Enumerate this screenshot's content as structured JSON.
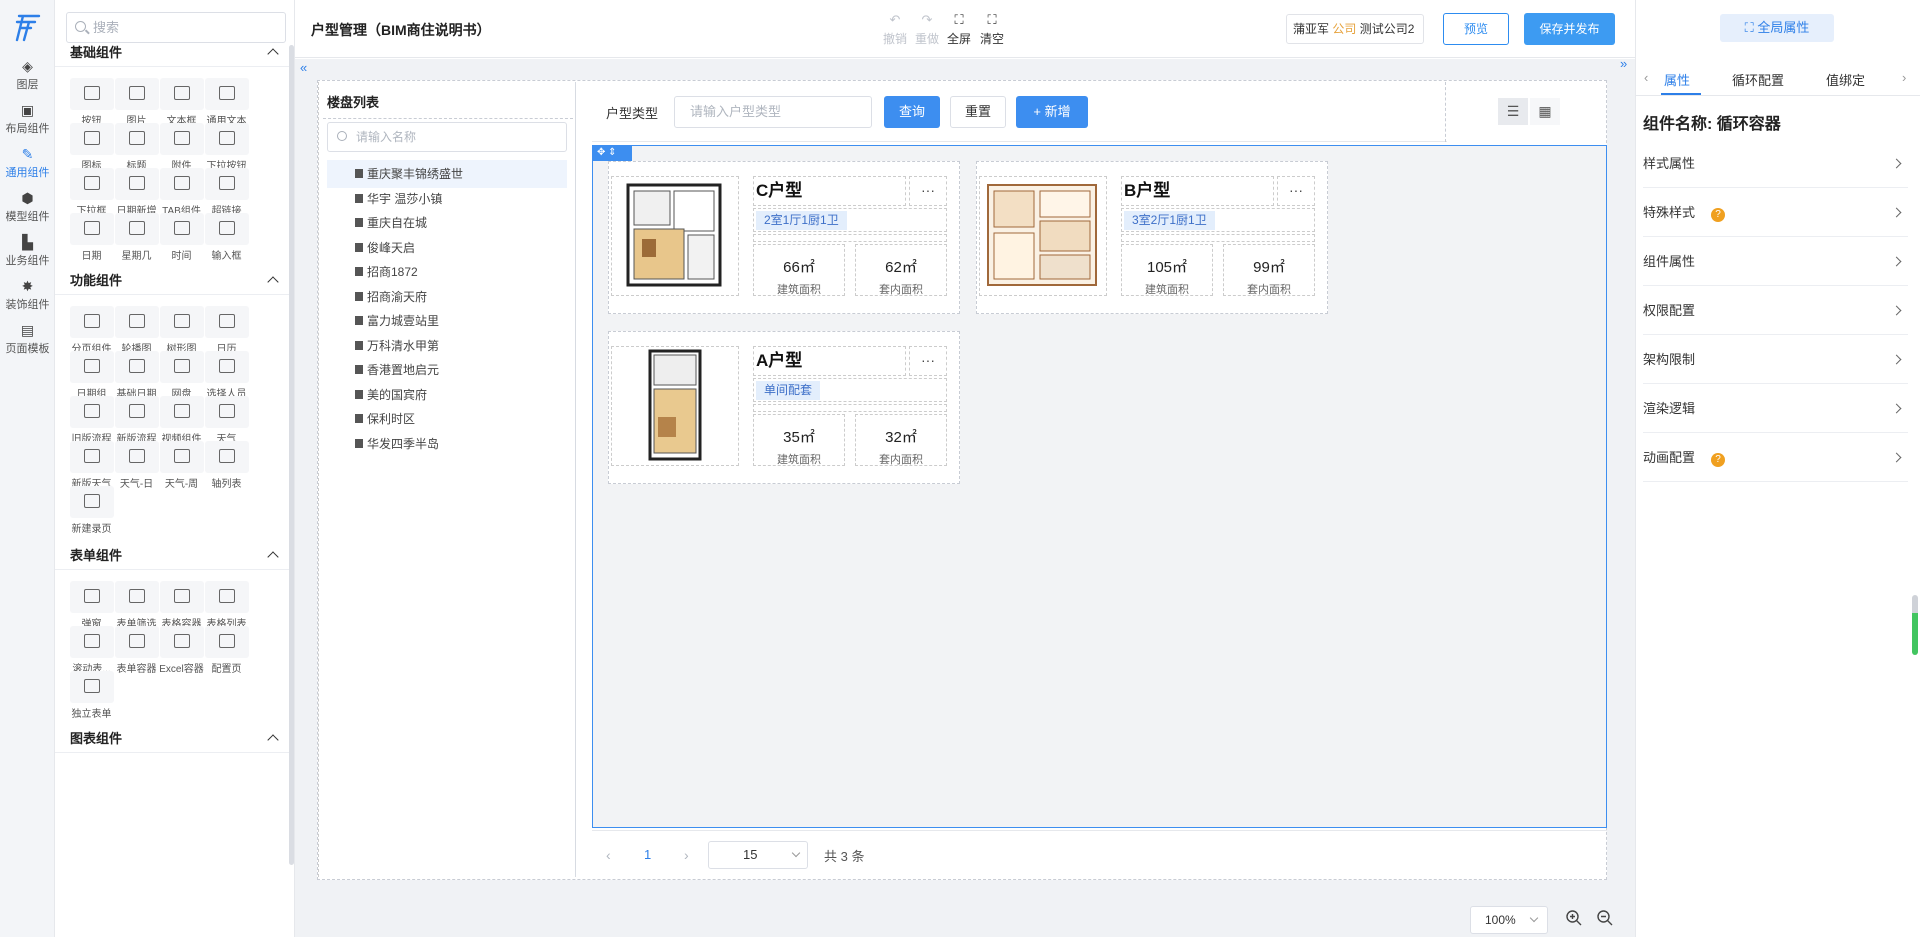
{
  "rail": {
    "items": [
      {
        "label": "图层",
        "icon": "layers-icon"
      },
      {
        "label": "布局组件",
        "icon": "layout-icon"
      },
      {
        "label": "通用组件",
        "icon": "pen-icon"
      },
      {
        "label": "模型组件",
        "icon": "cube-icon"
      },
      {
        "label": "业务组件",
        "icon": "building-icon"
      },
      {
        "label": "装饰组件",
        "icon": "star-icon"
      },
      {
        "label": "页面模板",
        "icon": "page-icon"
      }
    ],
    "active_index": 2
  },
  "library": {
    "search_placeholder": "搜索",
    "sections": [
      {
        "title": "基础组件",
        "items": [
          "按钮",
          "图片",
          "文本框",
          "通用文本",
          "图标",
          "标题",
          "附件",
          "下拉按钮",
          "下拉框",
          "日期新增",
          "TAB组件",
          "超链接",
          "日期",
          "星期几",
          "时间",
          "输入框"
        ]
      },
      {
        "title": "功能组件",
        "items": [
          "分页组件",
          "轮播图",
          "树形图",
          "日历",
          "日期组",
          "基础日期",
          "网盘",
          "选择人员",
          "旧版流程",
          "新版流程",
          "视频组件",
          "天气",
          "新版天气",
          "天气-日",
          "天气-周",
          "轴列表",
          "新建录页"
        ]
      },
      {
        "title": "表单组件",
        "items": [
          "弹窗",
          "表单筛选",
          "表格容器",
          "表格列表",
          "滚动表...",
          "表单容器",
          "Excel容器",
          "配置页",
          "独立表单"
        ]
      },
      {
        "title": "图表组件",
        "items": []
      }
    ]
  },
  "topbar": {
    "title": "户型管理（BIM商住说明书）",
    "tools": [
      {
        "label": "撤销",
        "icon": "undo-icon",
        "disabled": true
      },
      {
        "label": "重做",
        "icon": "redo-icon",
        "disabled": true
      },
      {
        "label": "全屏",
        "icon": "fullscreen-icon",
        "disabled": false
      },
      {
        "label": "清空",
        "icon": "clear-icon",
        "disabled": false
      }
    ],
    "user": "蒲亚军",
    "company_tag": "公司",
    "company": "测试公司2",
    "preview": "预览",
    "save": "保存并发布"
  },
  "tree": {
    "title": "楼盘列表",
    "placeholder": "请输入名称",
    "items": [
      "重庆聚丰锦绣盛世",
      "华宇 温莎小镇",
      "重庆自在城",
      "俊峰天启",
      "招商1872",
      "招商渝天府",
      "富力城壹站里",
      "万科清水甲第",
      "香港置地启元",
      "美的国宾府",
      "保利时区",
      "华发四季半岛"
    ],
    "selected_index": 0
  },
  "filter": {
    "label": "户型类型",
    "placeholder": "请输入户型类型",
    "query": "查询",
    "reset": "重置",
    "add": "+ 新增"
  },
  "cards": [
    {
      "title": "C户型",
      "tag": "2室1厅1厨1卫",
      "area1": "66㎡",
      "area1_label": "建筑面积",
      "area2": "62㎡",
      "area2_label": "套内面积",
      "more": "···"
    },
    {
      "title": "B户型",
      "tag": "3室2厅1厨1卫",
      "area1": "105㎡",
      "area1_label": "建筑面积",
      "area2": "99㎡",
      "area2_label": "套内面积",
      "more": "···"
    },
    {
      "title": "A户型",
      "tag": "单间配套",
      "area1": "35㎡",
      "area1_label": "建筑面积",
      "area2": "32㎡",
      "area2_label": "套内面积",
      "more": "···"
    }
  ],
  "pager": {
    "prev": "‹",
    "page": "1",
    "next": "›",
    "size": "15",
    "total": "共 3 条"
  },
  "zoom": {
    "value": "100%"
  },
  "right": {
    "global_button": "全局属性",
    "tabs": [
      "属性",
      "循环配置",
      "值绑定"
    ],
    "active_tab": 0,
    "component_name": "组件名称: 循环容器",
    "props": [
      {
        "label": "样式属性",
        "help": false
      },
      {
        "label": "特殊样式",
        "help": true
      },
      {
        "label": "组件属性",
        "help": false
      },
      {
        "label": "权限配置",
        "help": false
      },
      {
        "label": "架构限制",
        "help": false
      },
      {
        "label": "渲染逻辑",
        "help": false
      },
      {
        "label": "动画配置",
        "help": true
      }
    ],
    "help_mark": "?"
  },
  "colors": {
    "accent": "#3d8ef0",
    "active_tab": "#2d7fe8",
    "help": "#f0a020",
    "company_tag": "#e6a23c"
  }
}
